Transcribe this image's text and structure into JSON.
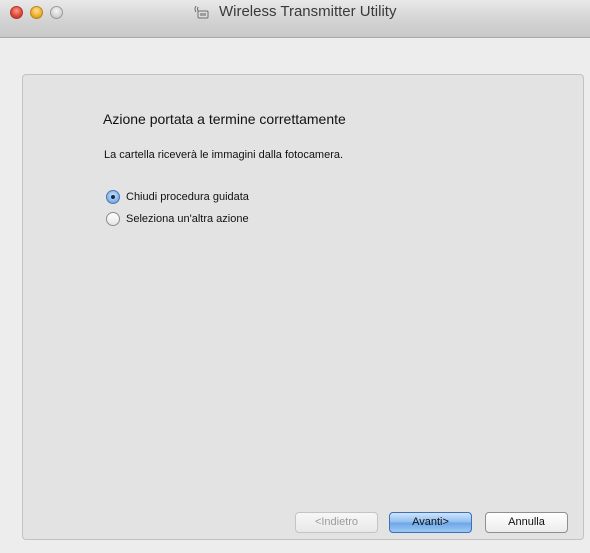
{
  "window": {
    "title": "Wireless Transmitter Utility",
    "title_icon": "wireless-transmitter-icon"
  },
  "content": {
    "heading": "Azione portata a termine correttamente",
    "message": "La cartella riceverà le immagini dalla fotocamera.",
    "options": [
      {
        "label": "Chiudi procedura guidata",
        "selected": true
      },
      {
        "label": "Seleziona un'altra azione",
        "selected": false
      }
    ]
  },
  "buttons": {
    "back_label": "<Indietro",
    "back_enabled": false,
    "next_label": "Avanti>",
    "next_default": true,
    "cancel_label": "Annulla"
  },
  "colors": {
    "default_button": "#8dbdf0",
    "selected_radio": "#5d91d3"
  }
}
